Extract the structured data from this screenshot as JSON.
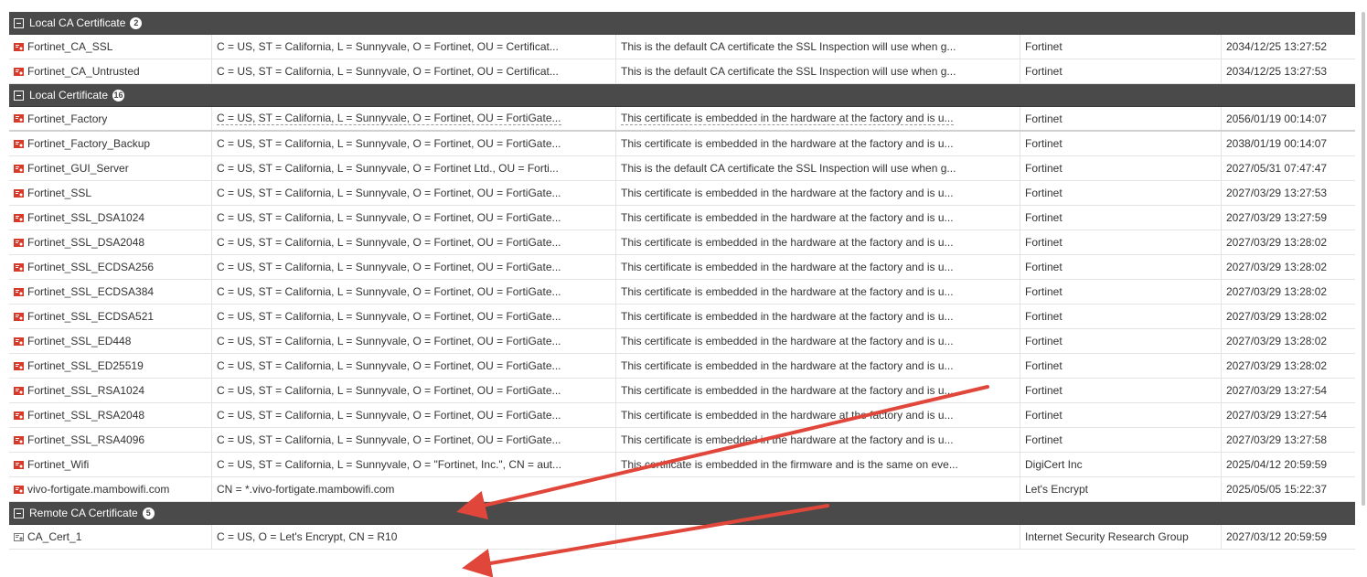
{
  "groups": [
    {
      "label": "Local CA Certificate",
      "count": "2",
      "rows": [
        {
          "name": "Fortinet_CA_SSL",
          "subject": "C = US, ST = California, L = Sunnyvale, O = Fortinet, OU = Certificat...",
          "comments": "This is the default CA certificate the SSL Inspection will use when g...",
          "issuer": "Fortinet",
          "expires": "2034/12/25 13:27:52"
        },
        {
          "name": "Fortinet_CA_Untrusted",
          "subject": "C = US, ST = California, L = Sunnyvale, O = Fortinet, OU = Certificat...",
          "comments": "This is the default CA certificate the SSL Inspection will use when g...",
          "issuer": "Fortinet",
          "expires": "2034/12/25 13:27:53"
        }
      ]
    },
    {
      "label": "Local Certificate",
      "count": "16",
      "rows": [
        {
          "name": "Fortinet_Factory",
          "subject": "C = US, ST = California, L = Sunnyvale, O = Fortinet, OU = FortiGate...",
          "comments": "This certificate is embedded in the hardware at the factory and is u...",
          "issuer": "Fortinet",
          "expires": "2056/01/19 00:14:07"
        },
        {
          "name": "Fortinet_Factory_Backup",
          "subject": "C = US, ST = California, L = Sunnyvale, O = Fortinet, OU = FortiGate...",
          "comments": "This certificate is embedded in the hardware at the factory and is u...",
          "issuer": "Fortinet",
          "expires": "2038/01/19 00:14:07"
        },
        {
          "name": "Fortinet_GUI_Server",
          "subject": "C = US, ST = California, L = Sunnyvale, O = Fortinet Ltd., OU = Forti...",
          "comments": "This is the default CA certificate the SSL Inspection will use when g...",
          "issuer": "Fortinet",
          "expires": "2027/05/31 07:47:47"
        },
        {
          "name": "Fortinet_SSL",
          "subject": "C = US, ST = California, L = Sunnyvale, O = Fortinet, OU = FortiGate...",
          "comments": "This certificate is embedded in the hardware at the factory and is u...",
          "issuer": "Fortinet",
          "expires": "2027/03/29 13:27:53"
        },
        {
          "name": "Fortinet_SSL_DSA1024",
          "subject": "C = US, ST = California, L = Sunnyvale, O = Fortinet, OU = FortiGate...",
          "comments": "This certificate is embedded in the hardware at the factory and is u...",
          "issuer": "Fortinet",
          "expires": "2027/03/29 13:27:59"
        },
        {
          "name": "Fortinet_SSL_DSA2048",
          "subject": "C = US, ST = California, L = Sunnyvale, O = Fortinet, OU = FortiGate...",
          "comments": "This certificate is embedded in the hardware at the factory and is u...",
          "issuer": "Fortinet",
          "expires": "2027/03/29 13:28:02"
        },
        {
          "name": "Fortinet_SSL_ECDSA256",
          "subject": "C = US, ST = California, L = Sunnyvale, O = Fortinet, OU = FortiGate...",
          "comments": "This certificate is embedded in the hardware at the factory and is u...",
          "issuer": "Fortinet",
          "expires": "2027/03/29 13:28:02"
        },
        {
          "name": "Fortinet_SSL_ECDSA384",
          "subject": "C = US, ST = California, L = Sunnyvale, O = Fortinet, OU = FortiGate...",
          "comments": "This certificate is embedded in the hardware at the factory and is u...",
          "issuer": "Fortinet",
          "expires": "2027/03/29 13:28:02"
        },
        {
          "name": "Fortinet_SSL_ECDSA521",
          "subject": "C = US, ST = California, L = Sunnyvale, O = Fortinet, OU = FortiGate...",
          "comments": "This certificate is embedded in the hardware at the factory and is u...",
          "issuer": "Fortinet",
          "expires": "2027/03/29 13:28:02"
        },
        {
          "name": "Fortinet_SSL_ED448",
          "subject": "C = US, ST = California, L = Sunnyvale, O = Fortinet, OU = FortiGate...",
          "comments": "This certificate is embedded in the hardware at the factory and is u...",
          "issuer": "Fortinet",
          "expires": "2027/03/29 13:28:02"
        },
        {
          "name": "Fortinet_SSL_ED25519",
          "subject": "C = US, ST = California, L = Sunnyvale, O = Fortinet, OU = FortiGate...",
          "comments": "This certificate is embedded in the hardware at the factory and is u...",
          "issuer": "Fortinet",
          "expires": "2027/03/29 13:28:02"
        },
        {
          "name": "Fortinet_SSL_RSA1024",
          "subject": "C = US, ST = California, L = Sunnyvale, O = Fortinet, OU = FortiGate...",
          "comments": "This certificate is embedded in the hardware at the factory and is u...",
          "issuer": "Fortinet",
          "expires": "2027/03/29 13:27:54"
        },
        {
          "name": "Fortinet_SSL_RSA2048",
          "subject": "C = US, ST = California, L = Sunnyvale, O = Fortinet, OU = FortiGate...",
          "comments": "This certificate is embedded in the hardware at the factory and is u...",
          "issuer": "Fortinet",
          "expires": "2027/03/29 13:27:54"
        },
        {
          "name": "Fortinet_SSL_RSA4096",
          "subject": "C = US, ST = California, L = Sunnyvale, O = Fortinet, OU = FortiGate...",
          "comments": "This certificate is embedded in the hardware at the factory and is u...",
          "issuer": "Fortinet",
          "expires": "2027/03/29 13:27:58"
        },
        {
          "name": "Fortinet_Wifi",
          "subject": "C = US, ST = California, L = Sunnyvale, O = \"Fortinet, Inc.\", CN = aut...",
          "comments": "This certificate is embedded in the firmware and is the same on eve...",
          "issuer": "DigiCert Inc",
          "expires": "2025/04/12 20:59:59"
        },
        {
          "name": "vivo-fortigate.mambowifi.com",
          "subject": "CN = *.vivo-fortigate.mambowifi.com",
          "comments": "",
          "issuer": "Let's Encrypt",
          "expires": "2025/05/05 15:22:37"
        }
      ]
    },
    {
      "label": "Remote CA Certificate",
      "count": "5",
      "rows": [
        {
          "name": "CA_Cert_1",
          "subject": "C = US, O = Let's Encrypt, CN = R10",
          "comments": "",
          "issuer": "Internet Security Research Group",
          "expires": "2027/03/12 20:59:59"
        }
      ]
    }
  ],
  "icons": {
    "local_cert": "certificate-icon",
    "remote_cert": "remote-certificate-icon",
    "annotation": "red-arrow"
  },
  "colors": {
    "group_header": "#4a4a4a",
    "icon_red": "#d83a2a",
    "arrow_red": "#e0463a"
  }
}
